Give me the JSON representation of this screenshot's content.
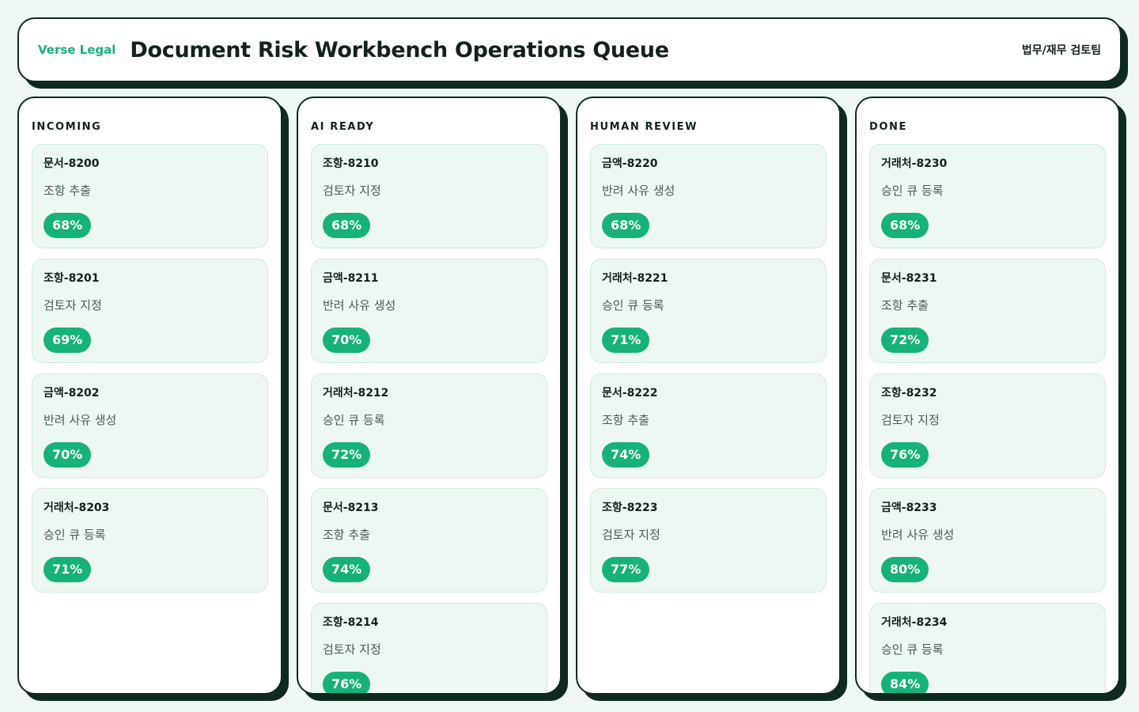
{
  "header": {
    "brand": "Verse Legal",
    "title": "Document Risk Workbench Operations Queue",
    "team": "법무/재무 검토팀"
  },
  "columns": [
    {
      "title": "INCOMING",
      "cards": [
        {
          "id": "문서-8200",
          "task": "조항 추출",
          "score": "68%"
        },
        {
          "id": "조항-8201",
          "task": "검토자 지정",
          "score": "69%"
        },
        {
          "id": "금액-8202",
          "task": "반려 사유 생성",
          "score": "70%"
        },
        {
          "id": "거래처-8203",
          "task": "승인 큐 등록",
          "score": "71%"
        }
      ]
    },
    {
      "title": "AI READY",
      "cards": [
        {
          "id": "조항-8210",
          "task": "검토자 지정",
          "score": "68%"
        },
        {
          "id": "금액-8211",
          "task": "반려 사유 생성",
          "score": "70%"
        },
        {
          "id": "거래처-8212",
          "task": "승인 큐 등록",
          "score": "72%"
        },
        {
          "id": "문서-8213",
          "task": "조항 추출",
          "score": "74%"
        },
        {
          "id": "조항-8214",
          "task": "검토자 지정",
          "score": "76%"
        }
      ]
    },
    {
      "title": "HUMAN REVIEW",
      "cards": [
        {
          "id": "금액-8220",
          "task": "반려 사유 생성",
          "score": "68%"
        },
        {
          "id": "거래처-8221",
          "task": "승인 큐 등록",
          "score": "71%"
        },
        {
          "id": "문서-8222",
          "task": "조항 추출",
          "score": "74%"
        },
        {
          "id": "조항-8223",
          "task": "검토자 지정",
          "score": "77%"
        }
      ]
    },
    {
      "title": "DONE",
      "cards": [
        {
          "id": "거래처-8230",
          "task": "승인 큐 등록",
          "score": "68%"
        },
        {
          "id": "문서-8231",
          "task": "조항 추출",
          "score": "72%"
        },
        {
          "id": "조항-8232",
          "task": "검토자 지정",
          "score": "76%"
        },
        {
          "id": "금액-8233",
          "task": "반려 사유 생성",
          "score": "80%"
        },
        {
          "id": "거래처-8234",
          "task": "승인 큐 등록",
          "score": "84%"
        }
      ]
    }
  ],
  "colors": {
    "accent": "#16b27a",
    "border": "#0f2a1f",
    "card_bg": "#eef8f2",
    "page_bg": "#eff8f3"
  }
}
